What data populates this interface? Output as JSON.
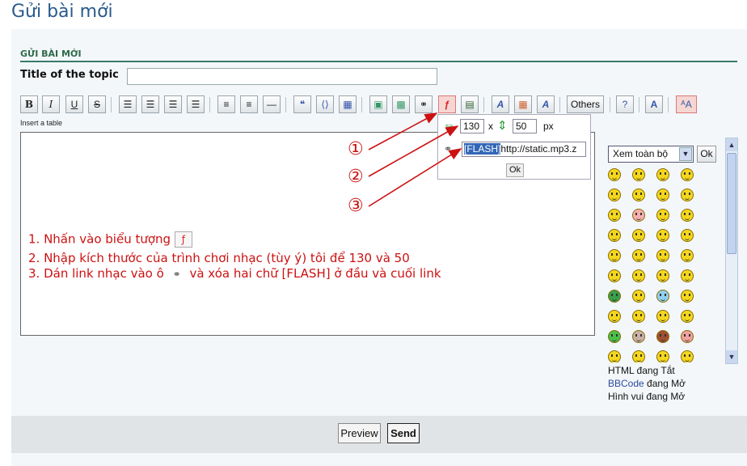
{
  "page_title": "Gửi bài mới",
  "section_title": "GỬI BÀI MỚI",
  "topic": {
    "label": "Title of the topic",
    "value": ""
  },
  "toolbar": {
    "others_label": "Others",
    "tooltip": "Insert a table"
  },
  "flash_popup": {
    "width_value": "130",
    "x_label": "x",
    "height_value": "50",
    "unit": "px",
    "url_prefix": "[FLASH]",
    "url_rest": "http://static.mp3.z",
    "ok_label": "Ok"
  },
  "annotations": {
    "circle1": "①",
    "circle2": "②",
    "circle3": "③",
    "line1": "1. Nhấn vào biểu tượng",
    "line2": "2. Nhập kích thước của trình chơi nhạc (tùy ý) tôi để 130 và 50",
    "line3a": "3. Dán link nhạc vào ô",
    "line3b": "và xóa hai chữ [FLASH] ở đầu và cuối link"
  },
  "smileys": {
    "select_value": "Xem toàn bộ",
    "ok_label": "Ok"
  },
  "status": {
    "html_state": "HTML đang Tắt",
    "bbcode_link": "BBCode",
    "bbcode_state": "đang Mở",
    "images_state": "Hình vui đang Mở"
  },
  "footer": {
    "preview_label": "Preview",
    "send_label": "Send"
  },
  "colors": {
    "annotation": "#cc1111",
    "title": "#2a5a8c",
    "section": "#2f6a4a"
  }
}
